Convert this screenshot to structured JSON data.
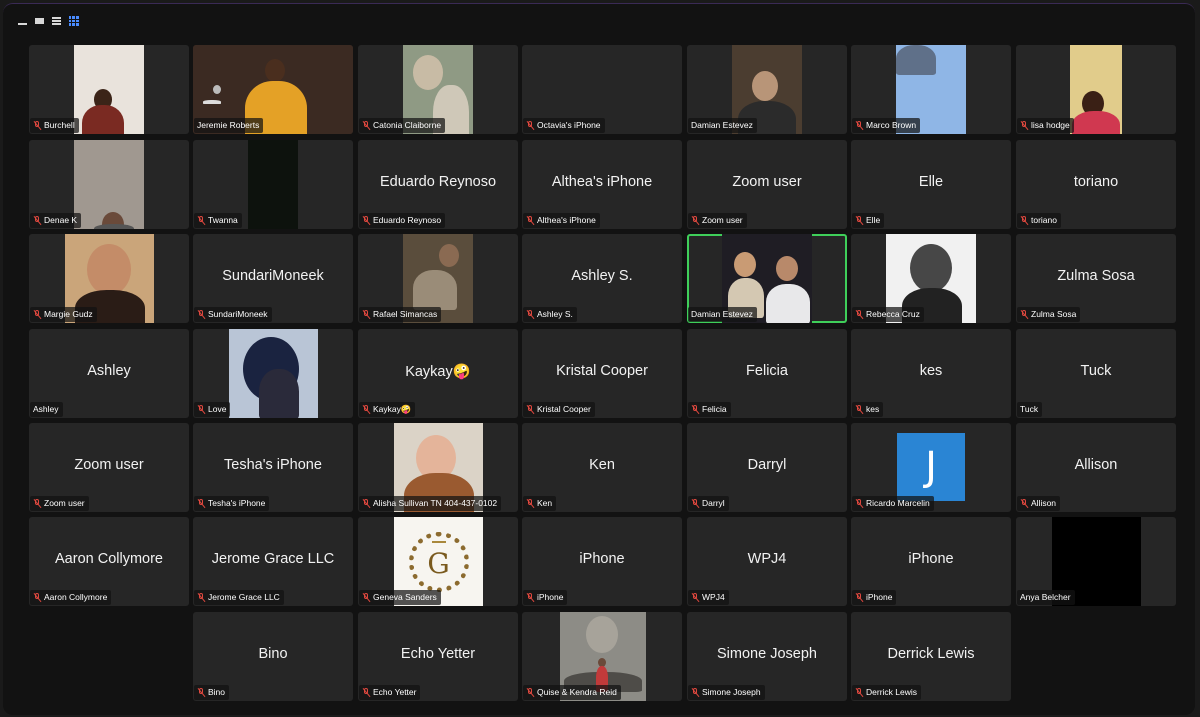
{
  "toolbar": {
    "icons": [
      "minimize-icon",
      "speaker-view-icon",
      "sidebar-view-icon",
      "gallery-view-icon"
    ]
  },
  "colors": {
    "tile_bg": "#262626",
    "active_border": "#3fcf5a",
    "muted": "#e0483f",
    "grid_icon": "#4a8cff"
  },
  "participants": [
    {
      "label": "Burchell",
      "big": "",
      "muted": true,
      "video": "v1"
    },
    {
      "label": "Jeremie Roberts",
      "big": "",
      "muted": false,
      "video": "v2"
    },
    {
      "label": "Catonia Claiborne",
      "big": "",
      "muted": true,
      "video": "v3"
    },
    {
      "label": "Octavia's iPhone",
      "big": "",
      "muted": true,
      "video": "dark"
    },
    {
      "label": "Damian Estevez",
      "big": "",
      "muted": false,
      "video": "v5"
    },
    {
      "label": "Marco Brown",
      "big": "",
      "muted": true,
      "video": "v6"
    },
    {
      "label": "lisa hodge",
      "big": "",
      "muted": true,
      "video": "v7"
    },
    {
      "label": "Denae K",
      "big": "",
      "muted": true,
      "video": "v8"
    },
    {
      "label": "Twanna",
      "big": "",
      "muted": true,
      "video": "v9"
    },
    {
      "label": "Eduardo Reynoso",
      "big": "Eduardo Reynoso",
      "muted": true,
      "video": ""
    },
    {
      "label": "Althea's iPhone",
      "big": "Althea's iPhone",
      "muted": true,
      "video": ""
    },
    {
      "label": "Zoom user",
      "big": "Zoom user",
      "muted": true,
      "video": ""
    },
    {
      "label": "Elle",
      "big": "Elle",
      "muted": true,
      "video": ""
    },
    {
      "label": "toriano",
      "big": "toriano",
      "muted": true,
      "video": ""
    },
    {
      "label": "Margie Gudz",
      "big": "",
      "muted": true,
      "video": "v10"
    },
    {
      "label": "SundariMoneek",
      "big": "SundariMoneek",
      "muted": true,
      "video": ""
    },
    {
      "label": "Rafael Simancas",
      "big": "",
      "muted": true,
      "video": "v11"
    },
    {
      "label": "Ashley S.",
      "big": "Ashley S.",
      "muted": true,
      "video": ""
    },
    {
      "label": "Damian Estevez",
      "big": "",
      "muted": false,
      "video": "v12",
      "active": true
    },
    {
      "label": "Rebecca Cruz",
      "big": "",
      "muted": true,
      "video": "v13"
    },
    {
      "label": "Zulma Sosa",
      "big": "Zulma Sosa",
      "muted": true,
      "video": ""
    },
    {
      "label": "Ashley",
      "big": "Ashley",
      "muted": false,
      "video": ""
    },
    {
      "label": "Love",
      "big": "",
      "muted": true,
      "video": "v14"
    },
    {
      "label": "Kaykay🤪",
      "big": "Kaykay🤪",
      "muted": true,
      "video": ""
    },
    {
      "label": "Kristal Cooper",
      "big": "Kristal Cooper",
      "muted": true,
      "video": ""
    },
    {
      "label": "Felicia",
      "big": "Felicia",
      "muted": true,
      "video": ""
    },
    {
      "label": "kes",
      "big": "kes",
      "muted": true,
      "video": ""
    },
    {
      "label": "Tuck",
      "big": "Tuck",
      "muted": false,
      "video": ""
    },
    {
      "label": "Zoom user",
      "big": "Zoom user",
      "muted": true,
      "video": ""
    },
    {
      "label": "Tesha's iPhone",
      "big": "Tesha's iPhone",
      "muted": true,
      "video": ""
    },
    {
      "label": "Alisha Sullivan TN 404-437-0102",
      "big": "",
      "muted": true,
      "video": "v15"
    },
    {
      "label": "Ken",
      "big": "Ken",
      "muted": true,
      "video": ""
    },
    {
      "label": "Darryl",
      "big": "Darryl",
      "muted": true,
      "video": ""
    },
    {
      "label": "Ricardo Marcelin",
      "big": "",
      "muted": true,
      "video": "javatar",
      "avatar_letter": "J"
    },
    {
      "label": "Allison",
      "big": "Allison",
      "muted": true,
      "video": ""
    },
    {
      "label": "Aaron Collymore",
      "big": "Aaron Collymore",
      "muted": true,
      "video": ""
    },
    {
      "label": "Jerome Grace LLC",
      "big": "Jerome Grace LLC",
      "muted": true,
      "video": ""
    },
    {
      "label": "Geneva Sanders",
      "big": "",
      "muted": true,
      "video": "logo",
      "logo_letter": "G"
    },
    {
      "label": "iPhone",
      "big": "iPhone",
      "muted": true,
      "video": ""
    },
    {
      "label": "WPJ4",
      "big": "WPJ4",
      "muted": true,
      "video": ""
    },
    {
      "label": "iPhone",
      "big": "iPhone",
      "muted": true,
      "video": ""
    },
    {
      "label": "Anya Belcher",
      "big": "",
      "muted": false,
      "video": "black"
    },
    {
      "label": "Bino",
      "big": "Bino",
      "muted": true,
      "video": ""
    },
    {
      "label": "Echo Yetter",
      "big": "Echo Yetter",
      "muted": true,
      "video": ""
    },
    {
      "label": "Quise & Kendra Reid",
      "big": "",
      "muted": true,
      "video": "v16"
    },
    {
      "label": "Simone Joseph",
      "big": "Simone Joseph",
      "muted": true,
      "video": ""
    },
    {
      "label": "Derrick Lewis",
      "big": "Derrick Lewis",
      "muted": true,
      "video": ""
    }
  ]
}
